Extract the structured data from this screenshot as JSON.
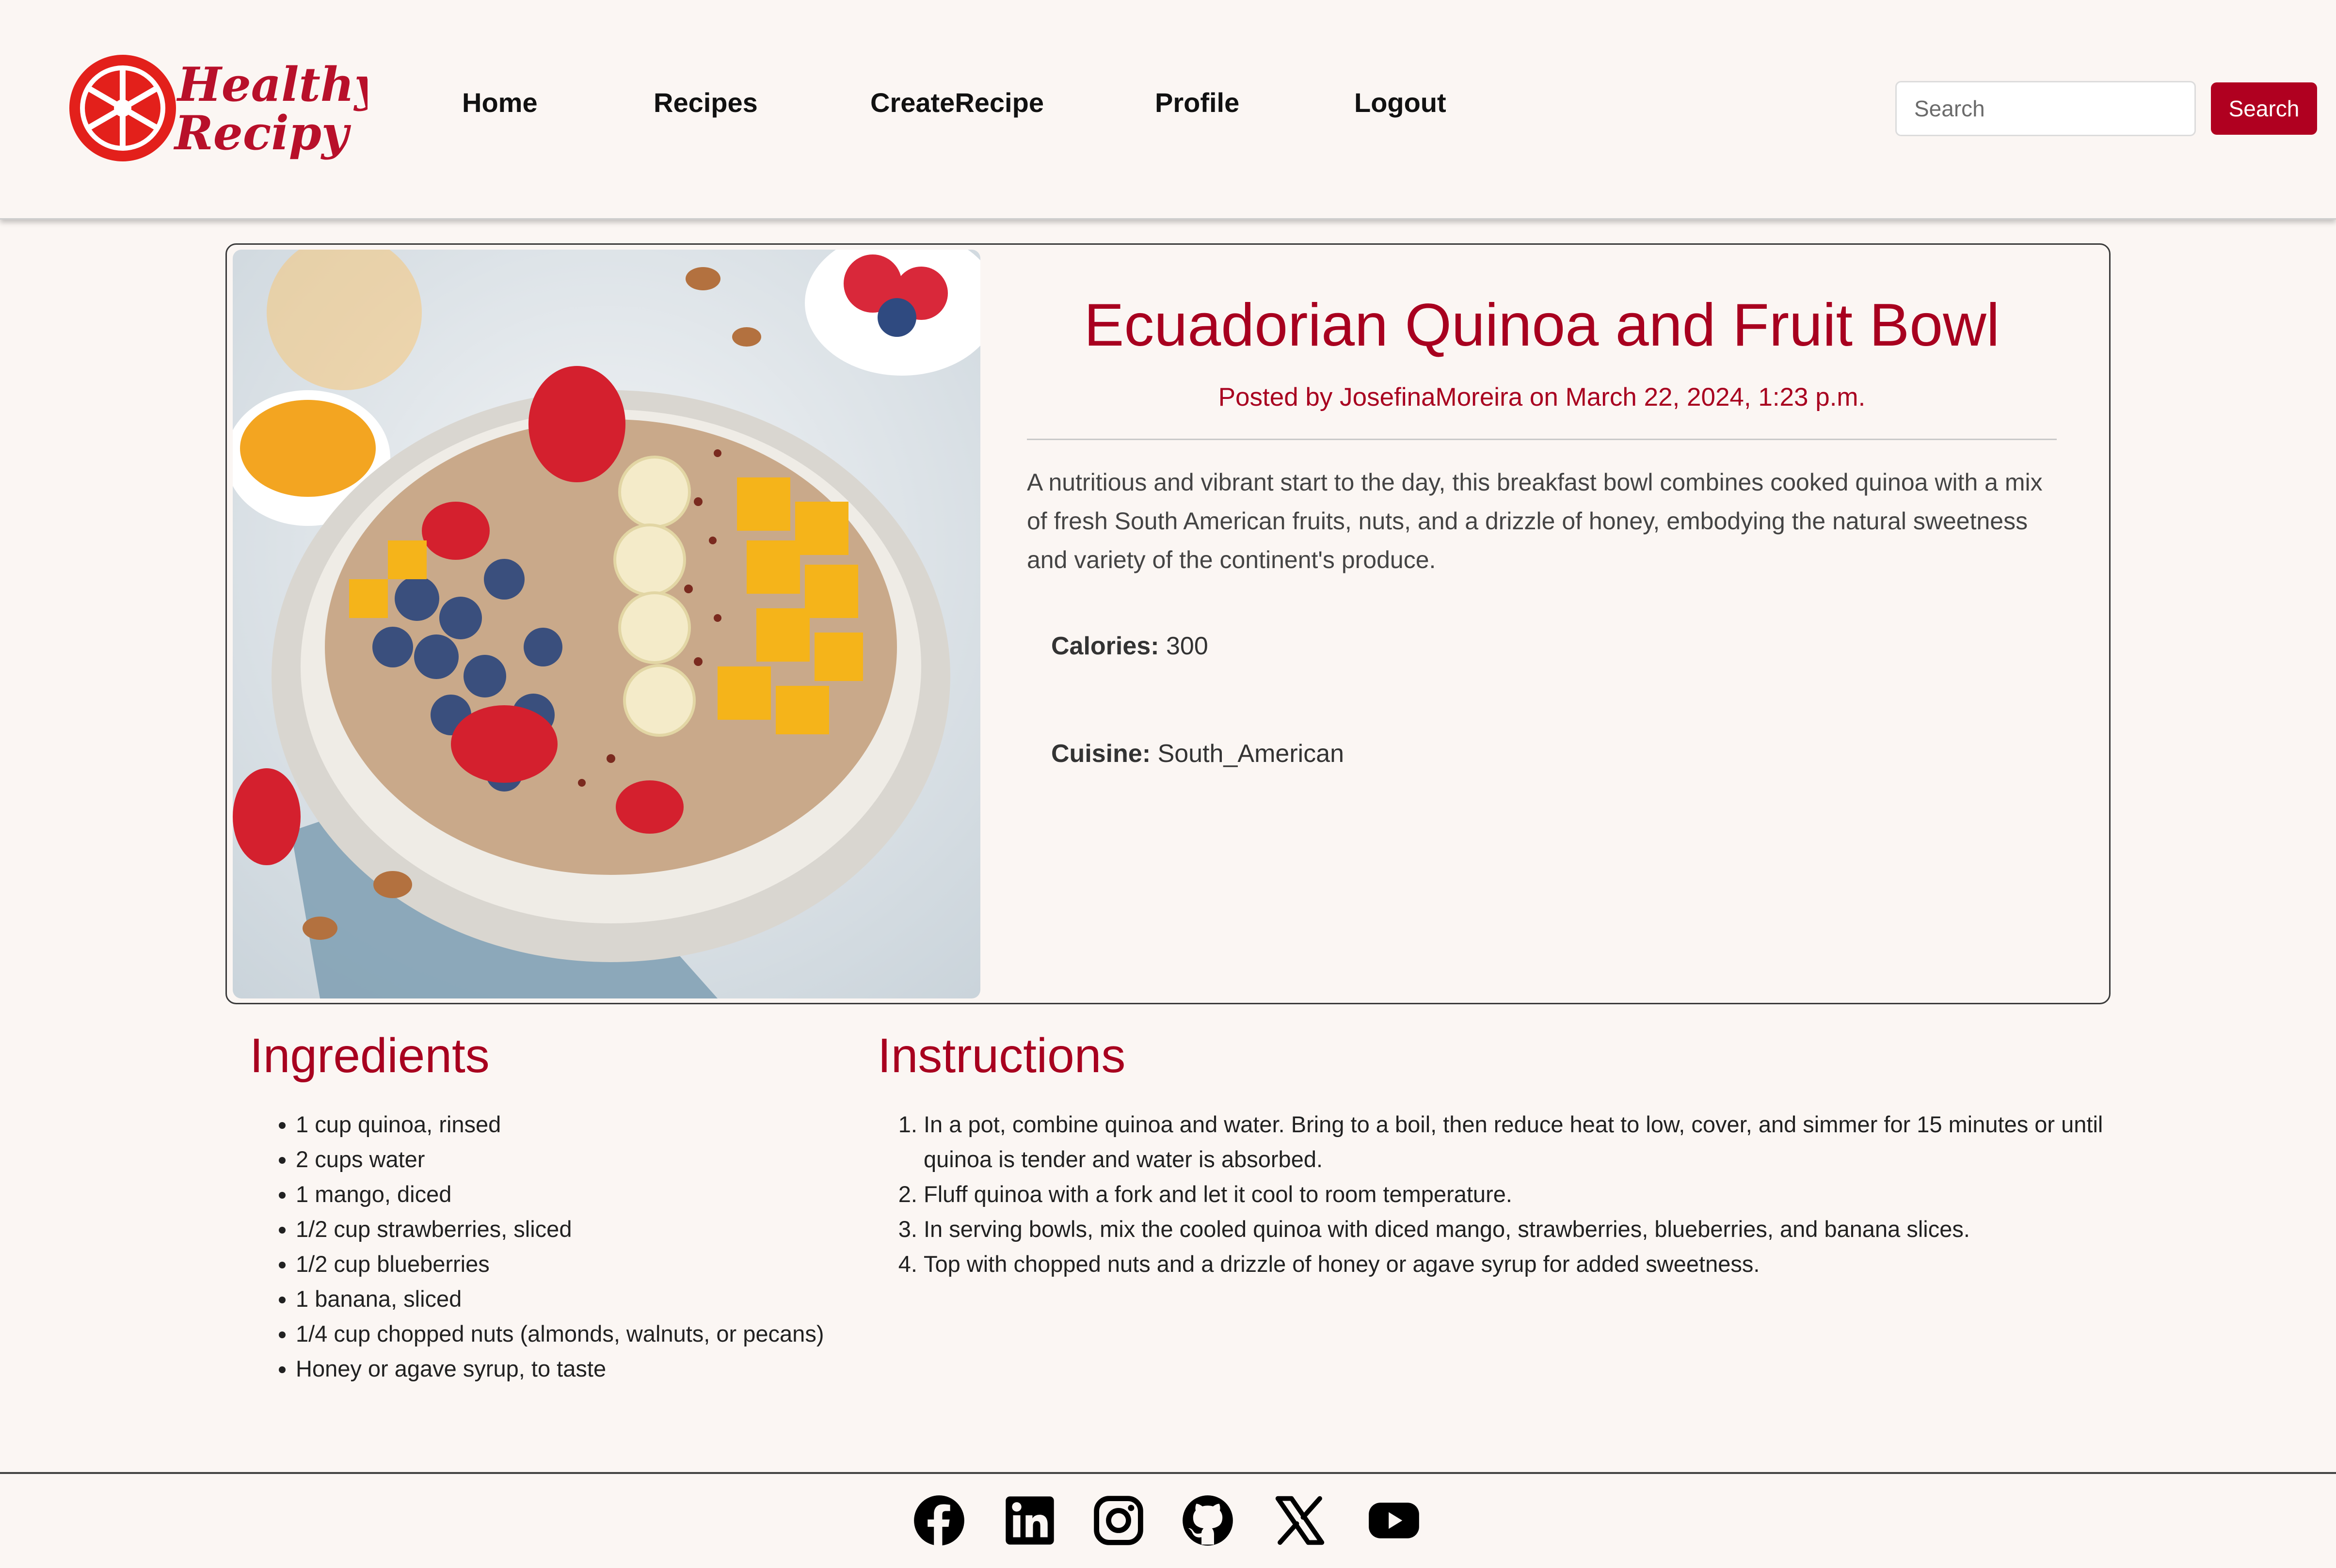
{
  "brand": {
    "logo_line1": "Healthy",
    "logo_line2": "Recipy",
    "logo_color": "#c8102e"
  },
  "nav": {
    "items": [
      {
        "label": "Home"
      },
      {
        "label": "Recipes"
      },
      {
        "label": "CreateRecipe"
      },
      {
        "label": "Profile"
      },
      {
        "label": "Logout"
      }
    ]
  },
  "search": {
    "placeholder": "Search",
    "value": "",
    "button_label": "Search"
  },
  "recipe": {
    "title": "Ecuadorian Quinoa and Fruit Bowl",
    "posted_prefix": "Posted by ",
    "author": "JosefinaMoreira",
    "posted_on": " on ",
    "date": "March 22, 2024, 1:23 p.m.",
    "description": "A nutritious and vibrant start to the day, this breakfast bowl combines cooked quinoa with a mix of fresh South American fruits, nuts, and a drizzle of honey, embodying the natural sweetness and variety of the continent's produce.",
    "calories_label": "Calories:",
    "calories_value": " 300",
    "cuisine_label": "Cuisine:",
    "cuisine_value": " South_American"
  },
  "ingredients": {
    "heading": "Ingredients",
    "items": [
      "1 cup quinoa, rinsed",
      "2 cups water",
      "1 mango, diced",
      "1/2 cup strawberries, sliced",
      "1/2 cup blueberries",
      "1 banana, sliced",
      "1/4 cup chopped nuts (almonds, walnuts, or pecans)",
      "Honey or agave syrup, to taste"
    ]
  },
  "instructions": {
    "heading": "Instructions",
    "steps": [
      "In a pot, combine quinoa and water. Bring to a boil, then reduce heat to low, cover, and simmer for 15 minutes or until quinoa is tender and water is absorbed.",
      "Fluff quinoa with a fork and let it cool to room temperature.",
      "In serving bowls, mix the cooled quinoa with diced mango, strawberries, blueberries, and banana slices.",
      "Top with chopped nuts and a drizzle of honey or agave syrup for added sweetness."
    ]
  },
  "footer": {
    "social_icons": [
      "facebook-icon",
      "linkedin-icon",
      "instagram-icon",
      "github-icon",
      "x-icon",
      "youtube-icon"
    ]
  },
  "colors": {
    "accent": "#a8001f",
    "button": "#b00020",
    "background": "#fbf6f3"
  }
}
